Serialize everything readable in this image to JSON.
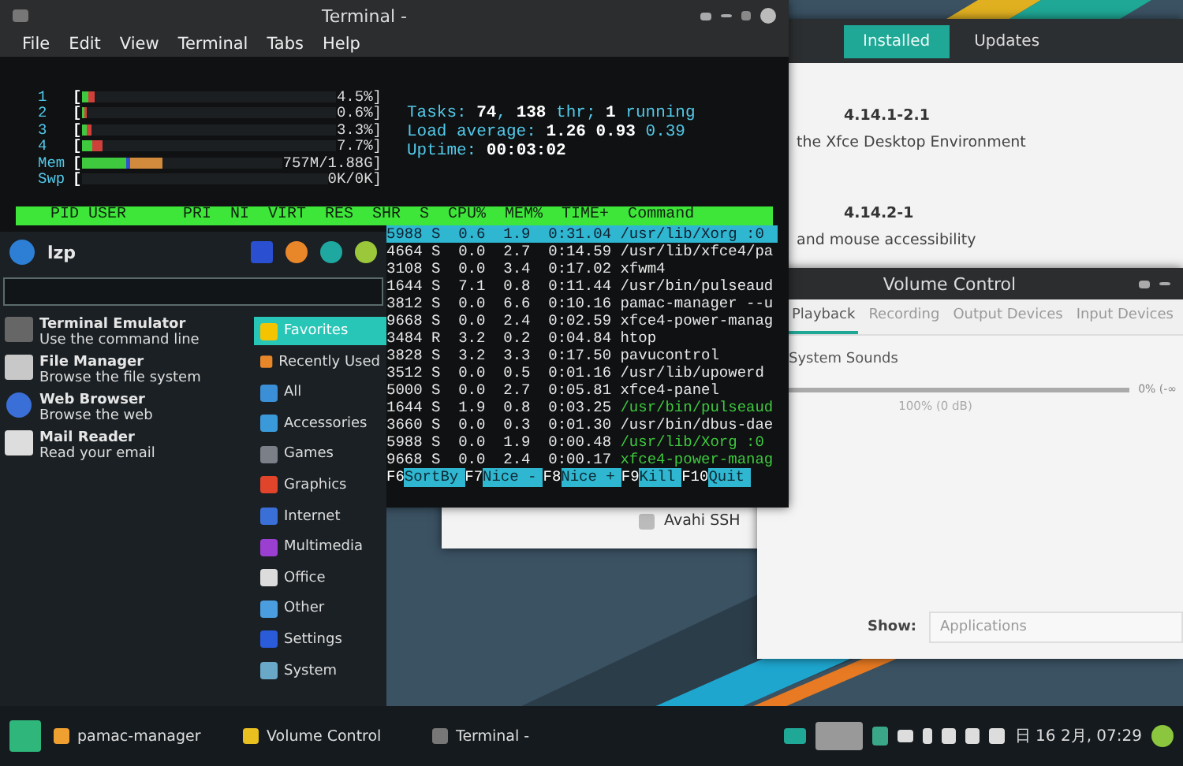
{
  "terminal": {
    "title": "Terminal -",
    "menu": [
      "File",
      "Edit",
      "View",
      "Terminal",
      "Tabs",
      "Help"
    ],
    "meters": [
      {
        "label": "1",
        "open": "[",
        "level": 0.05,
        "reading": "4.5%]"
      },
      {
        "label": "2",
        "open": "[",
        "level": 0.02,
        "reading": "0.6%]"
      },
      {
        "label": "3",
        "open": "[",
        "level": 0.04,
        "reading": "3.3%]"
      },
      {
        "label": "4",
        "open": "[",
        "level": 0.08,
        "reading": "7.7%]"
      },
      {
        "label": "Mem",
        "open": "[",
        "level": 0.4,
        "reading": "757M/1.88G]"
      },
      {
        "label": "Swp",
        "open": "[",
        "level": 0,
        "reading": "0K/0K]"
      }
    ],
    "summary": [
      "Tasks: **74**, **138** thr; **1** running",
      "Load average: **1.26** **0.93** 0.39",
      "Uptime: **00:03:02**"
    ],
    "columns": [
      "PID",
      "USER",
      "PRI",
      "NI",
      "VIRT",
      "RES",
      "SHR",
      "S",
      "CPU%",
      "MEM%",
      "TIME+",
      "Command"
    ],
    "rows": [
      {
        "stats": "5988 S  0.6  1.9  0:31.04",
        "command": "/usr/lib/Xorg :0",
        "kind": "process",
        "selected": true
      },
      {
        "stats": "4664 S  0.0  2.7  0:14.59",
        "command": "/usr/lib/xfce4/pa",
        "kind": "process",
        "selected": false
      },
      {
        "stats": "3108 S  0.0  3.4  0:17.02",
        "command": "xfwm4",
        "kind": "process",
        "selected": false
      },
      {
        "stats": "1644 S  7.1  0.8  0:11.44",
        "command": "/usr/bin/pulseaud",
        "kind": "process",
        "selected": false
      },
      {
        "stats": "3812 S  0.0  6.6  0:10.16",
        "command": "pamac-manager --u",
        "kind": "process",
        "selected": false
      },
      {
        "stats": "9668 S  0.0  2.4  0:02.59",
        "command": "xfce4-power-manag",
        "kind": "process",
        "selected": false
      },
      {
        "stats": "3484 R  3.2  0.2  0:04.84",
        "command": "htop",
        "kind": "process",
        "selected": false
      },
      {
        "stats": "3828 S  3.2  3.3  0:17.50",
        "command": "pavucontrol",
        "kind": "process",
        "selected": false
      },
      {
        "stats": "3512 S  0.0  0.5  0:01.16",
        "command": "/usr/lib/upowerd",
        "kind": "process",
        "selected": false
      },
      {
        "stats": "5000 S  0.0  2.7  0:05.81",
        "command": "xfce4-panel",
        "kind": "process",
        "selected": false
      },
      {
        "stats": "1644 S  1.9  0.8  0:03.25",
        "command": "/usr/bin/pulseaud",
        "kind": "thread",
        "selected": false
      },
      {
        "stats": "3660 S  0.0  0.3  0:01.30",
        "command": "/usr/bin/dbus-dae",
        "kind": "process",
        "selected": false
      },
      {
        "stats": "5988 S  0.0  1.9  0:00.48",
        "command": "/usr/lib/Xorg :0",
        "kind": "thread",
        "selected": false
      },
      {
        "stats": "9668 S  0.0  2.4  0:00.17",
        "command": "xfce4-power-manag",
        "kind": "thread",
        "selected": false
      }
    ],
    "keys": [
      {
        "key": "F6",
        "label": "SortBy"
      },
      {
        "key": "F7",
        "label": "Nice -"
      },
      {
        "key": "F8",
        "label": "Nice +"
      },
      {
        "key": "F9",
        "label": "Kill"
      },
      {
        "key": "F10",
        "label": "Quit"
      }
    ]
  },
  "pamac": {
    "tabs": [
      {
        "label": "Installed",
        "selected": true
      },
      {
        "label": "Updates",
        "selected": false
      }
    ],
    "packages": [
      {
        "version": "4.14.1-2.1",
        "description": "the Xfce Desktop Environment"
      },
      {
        "version": "4.14.2-1",
        "description": "and mouse accessibility"
      }
    ],
    "footer_item": "Avahi SSH"
  },
  "volume": {
    "title": "Volume Control",
    "tabs": [
      {
        "label": "Playback",
        "selected": true
      },
      {
        "label": "Recording",
        "selected": false
      },
      {
        "label": "Output Devices",
        "selected": false
      },
      {
        "label": "Input Devices",
        "selected": false
      }
    ],
    "stream": {
      "name": "System Sounds",
      "level": 1,
      "reading": "100% (0 dB)",
      "min_label": "0% (-∞"
    },
    "show_label": "Show:",
    "show_value": "Applications"
  },
  "menu": {
    "user": "lzp",
    "favorites": [
      {
        "name": "Terminal Emulator",
        "description": "Use the command line"
      },
      {
        "name": "File Manager",
        "description": "Browse the file system"
      },
      {
        "name": "Web Browser",
        "description": "Browse the web"
      },
      {
        "name": "Mail Reader",
        "description": "Read your email"
      }
    ],
    "categories": [
      {
        "label": "Favorites",
        "selected": true
      },
      {
        "label": "Recently Used",
        "selected": false
      },
      {
        "label": "All",
        "selected": false
      },
      {
        "label": "Accessories",
        "selected": false
      },
      {
        "label": "Games",
        "selected": false
      },
      {
        "label": "Graphics",
        "selected": false
      },
      {
        "label": "Internet",
        "selected": false
      },
      {
        "label": "Multimedia",
        "selected": false
      },
      {
        "label": "Office",
        "selected": false
      },
      {
        "label": "Other",
        "selected": false
      },
      {
        "label": "Settings",
        "selected": false
      },
      {
        "label": "System",
        "selected": false
      }
    ]
  },
  "taskbar": {
    "tasks": [
      {
        "label": "pamac-manager"
      },
      {
        "label": "Volume Control"
      },
      {
        "label": "Terminal -"
      }
    ],
    "clock": "日 16 2月, 07:29"
  }
}
